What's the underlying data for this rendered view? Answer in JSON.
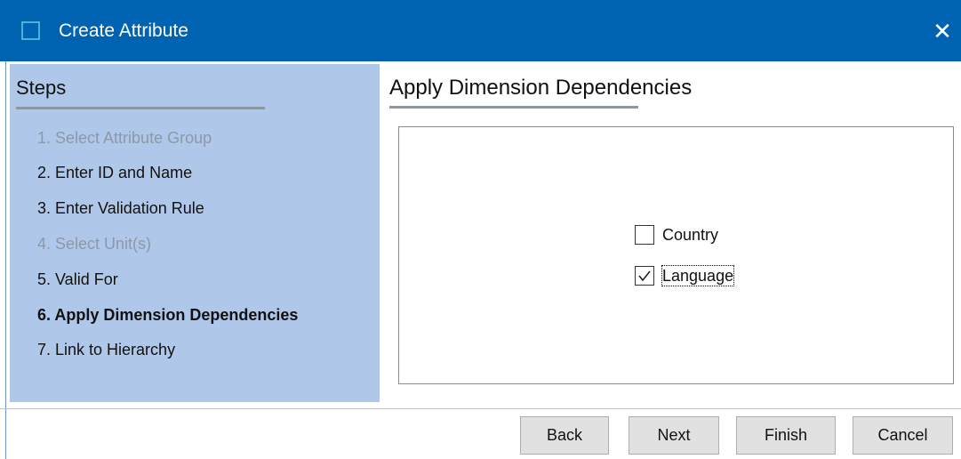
{
  "window": {
    "title": "Create Attribute",
    "close_glyph": "✕"
  },
  "steps": {
    "title": "Steps",
    "items": [
      {
        "label": "1. Select Attribute Group",
        "state": "disabled"
      },
      {
        "label": "2. Enter ID and Name",
        "state": "enabled"
      },
      {
        "label": "3. Enter Validation Rule",
        "state": "enabled"
      },
      {
        "label": "4. Select Unit(s)",
        "state": "disabled"
      },
      {
        "label": "5. Valid For",
        "state": "enabled"
      },
      {
        "label": "6. Apply Dimension Dependencies",
        "state": "current"
      },
      {
        "label": "7. Link to Hierarchy",
        "state": "enabled"
      }
    ]
  },
  "main": {
    "heading": "Apply Dimension Dependencies",
    "options": [
      {
        "label": "Country",
        "checked": false
      },
      {
        "label": "Language",
        "checked": true
      }
    ]
  },
  "buttons": {
    "back": "Back",
    "next": "Next",
    "finish": "Finish",
    "cancel": "Cancel"
  },
  "colors": {
    "titlebar": "#0063b1",
    "steps_panel": "#afc8ea",
    "disabled_text": "#8d98a7",
    "icon_border": "#3fb7d7"
  }
}
